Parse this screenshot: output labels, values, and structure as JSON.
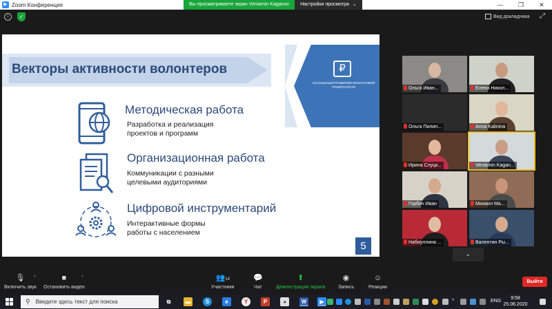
{
  "window": {
    "title": "Zoom Конференция"
  },
  "share_banner": {
    "message": "Вы просматриваете экран Veniamin Kaganov",
    "options_label": "Настройки просмотра",
    "options_caret": "⌄"
  },
  "top_controls": {
    "view_label": "Вид докладчика",
    "info_glyph": "i",
    "shield_glyph": "✓"
  },
  "slide": {
    "title": "Векторы активности волонтеров",
    "logo_glyph": "₽",
    "logo_text": "АССОЦИАЦИЯ РАЗВИТИЯ ФИНАНСОВОЙ ГРАМОТНОСТИ",
    "sections": [
      {
        "heading": "Методическая работа",
        "body": [
          "Разработка и реализация",
          "проектов и программ"
        ],
        "icon": "phone-globe-icon"
      },
      {
        "heading": "Организационная работа",
        "body": [
          "Коммуникации с разными",
          "целевыми аудиториями"
        ],
        "icon": "documents-search-icon"
      },
      {
        "heading": "Цифровой инструментарий",
        "body": [
          "Интерактивные формы",
          "работы с населением"
        ],
        "icon": "people-gear-icon"
      }
    ],
    "page_number": "5"
  },
  "participants": [
    {
      "name": "Ольга Иван...",
      "bg": "#8b8a86",
      "clothes": "#3a3a40",
      "skin": "#d8b8a2"
    },
    {
      "name": "Елена Никол...",
      "bg": "#cfd2c8",
      "clothes": "#222",
      "skin": "#c89a80"
    },
    {
      "name": "Ольга Пилип...",
      "bg": "#2b2b2b",
      "clothes": "#2b2b2b",
      "skin": "#2b2b2b"
    },
    {
      "name": "Anna Kalinina",
      "bg": "#d9d6c6",
      "clothes": "#5a4030",
      "skin": "#e0b79a"
    },
    {
      "name": "Ирина Слуцк...",
      "bg": "#5a3a2a",
      "clothes": "#c0304a",
      "skin": "#e3b89c"
    },
    {
      "name": "Veniamin Kagan...",
      "bg": "#d4d9dc",
      "clothes": "#3a4558",
      "skin": "#c99c84"
    },
    {
      "name": "Горбич Иван",
      "bg": "#d7d2c8",
      "clothes": "#2e3440",
      "skin": "#d5a98d"
    },
    {
      "name": "Михаил Ма...",
      "bg": "#8e6c56",
      "clothes": "#4a4a4a",
      "skin": "#c99478"
    },
    {
      "name": "Набиуллина ...",
      "bg": "#b82a36",
      "clothes": "#1e1e1e",
      "skin": "#e0bca2"
    },
    {
      "name": "Валентин Ры...",
      "bg": "#3a4f6a",
      "clothes": "#2a3a5a",
      "skin": "#d6aa8e"
    }
  ],
  "gallery_down_glyph": "⌄",
  "toolbar": {
    "mute_label": "Включить звук",
    "video_label": "Остановить видео",
    "participants_label": "Участники",
    "participants_count": "14",
    "chat_label": "Чат",
    "share_label": "Демонстрация экрана",
    "record_label": "Запись",
    "reactions_label": "Реакции",
    "leave_label": "Выйти",
    "caret": "^"
  },
  "taskbar": {
    "search_placeholder": "Введите здесь текст для поиска",
    "lang": "ENG",
    "time": "9:58",
    "date": "25.06.2020"
  },
  "colors": {
    "accent_blue": "#2f5d9c",
    "zoom_green": "#18a53a",
    "leave_red": "#e02828"
  }
}
